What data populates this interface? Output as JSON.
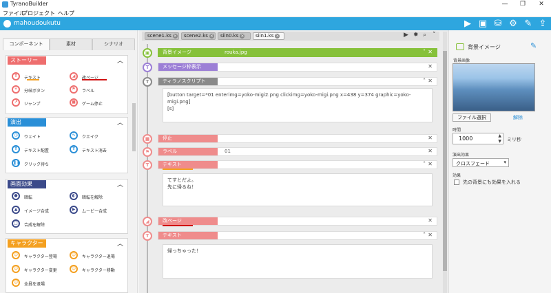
{
  "window": {
    "title": "TyranoBuilder",
    "minimize": "—",
    "maximize": "❐",
    "close": "✕"
  },
  "menu": [
    "ファイル",
    "プロジェクト",
    "ヘルプ"
  ],
  "project": {
    "name": "mahoudoukutu"
  },
  "toolbar_icons": [
    "play-icon",
    "save-icon",
    "deploy-icon",
    "settings-icon",
    "tools-icon",
    "export-icon"
  ],
  "left_tabs": [
    "コンポーネント",
    "素材",
    "シナリオ"
  ],
  "sections": [
    {
      "title": "ストーリー",
      "color": "#ee6e6e",
      "items": [
        "テキスト",
        "改ページ",
        "分岐ボタン",
        "ラベル",
        "ジャンプ",
        "ゲーム停止"
      ]
    },
    {
      "title": "演出",
      "color": "#2a8fd7",
      "items": [
        "ウェイト",
        "クエイク",
        "テキスト配置",
        "テキスト消去",
        "クリック待ち"
      ]
    },
    {
      "title": "画面効果",
      "color": "#3b4a8a",
      "items": [
        "暗転",
        "暗転を解除",
        "イメージ合成",
        "ムービー合成",
        "合成を解除"
      ]
    },
    {
      "title": "キャラクター",
      "color": "#f4a020",
      "items": [
        "キャラクター登場",
        "キャラクター退場",
        "キャラクター変更",
        "キャラクター移動",
        "全員を退場"
      ]
    }
  ],
  "scene_tabs": [
    {
      "label": "scene1.ks",
      "active": false
    },
    {
      "label": "scene2.ks",
      "active": false
    },
    {
      "label": "siin0.ks",
      "active": false
    },
    {
      "label": "siin1.ks",
      "active": true
    }
  ],
  "tags": {
    "bg": {
      "label": "背景イメージ",
      "value": "rouka.jpg",
      "color": "#86c13a"
    },
    "msgshow": {
      "label": "メッセージ枠表示",
      "color": "#9c7fd6"
    },
    "script": {
      "label": "ティラノスクリプト",
      "color": "#8a8a8a",
      "body": "[button target=*01 enterimg=yoko-migi2.png clickimg=yoko-migi.png x=438 y=374 graphic=yoko-migi.png]\n[s]"
    },
    "stop": {
      "label": "停止",
      "color": "#ef8c8c"
    },
    "label": {
      "label": "ラベル",
      "value": "01",
      "color": "#ef8c8c"
    },
    "text1": {
      "label": "テキスト",
      "color": "#ef8c8c",
      "body": "てすとだよ。\n先に帰るね！"
    },
    "page": {
      "label": "改ページ",
      "color": "#ef8c8c"
    },
    "text2": {
      "label": "テキスト",
      "color": "#ef8c8c",
      "body": "帰っちゃった！"
    }
  },
  "right": {
    "title": "背景イメージ",
    "image_label": "背景画像",
    "file_button": "ファイル選択",
    "clear_link": "解除",
    "time_label": "時間",
    "time_value": "1000",
    "time_unit": "ミリ秒",
    "effect_label": "演出効果",
    "effect_value": "クロスフェード",
    "extra_label": "効果",
    "checkbox_label": "先の背景にも効果を入れる"
  }
}
